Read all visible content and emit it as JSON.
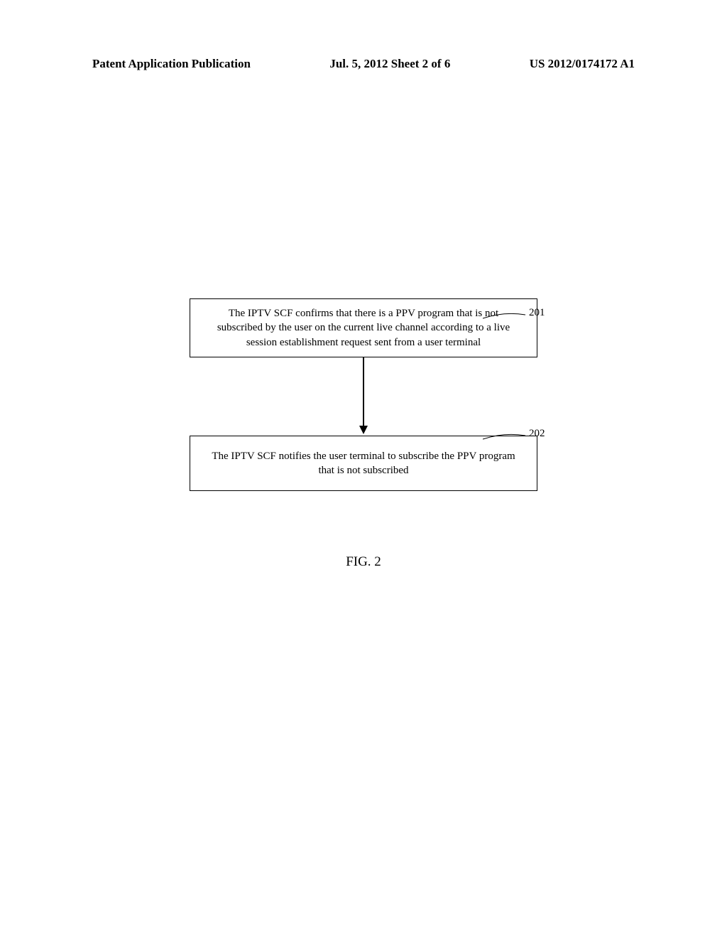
{
  "header": {
    "left": "Patent Application Publication",
    "center": "Jul. 5, 2012   Sheet 2 of 6",
    "right": "US 2012/0174172 A1"
  },
  "diagram": {
    "box1_text": "The IPTV SCF confirms that there is a PPV program that is not subscribed by the user on the current live channel according to a live session establishment request sent from a user terminal",
    "box2_text": "The IPTV SCF notifies the user terminal to subscribe the PPV program that is not subscribed",
    "callout1": "201",
    "callout2": "202"
  },
  "figure_label": "FIG. 2",
  "chart_data": {
    "type": "flowchart",
    "nodes": [
      {
        "id": "201",
        "label": "The IPTV SCF confirms that there is a PPV program that is not subscribed by the user on the current live channel according to a live session establishment request sent from a user terminal"
      },
      {
        "id": "202",
        "label": "The IPTV SCF notifies the user terminal to subscribe the PPV program that is not subscribed"
      }
    ],
    "edges": [
      {
        "from": "201",
        "to": "202"
      }
    ],
    "title": "FIG. 2"
  }
}
